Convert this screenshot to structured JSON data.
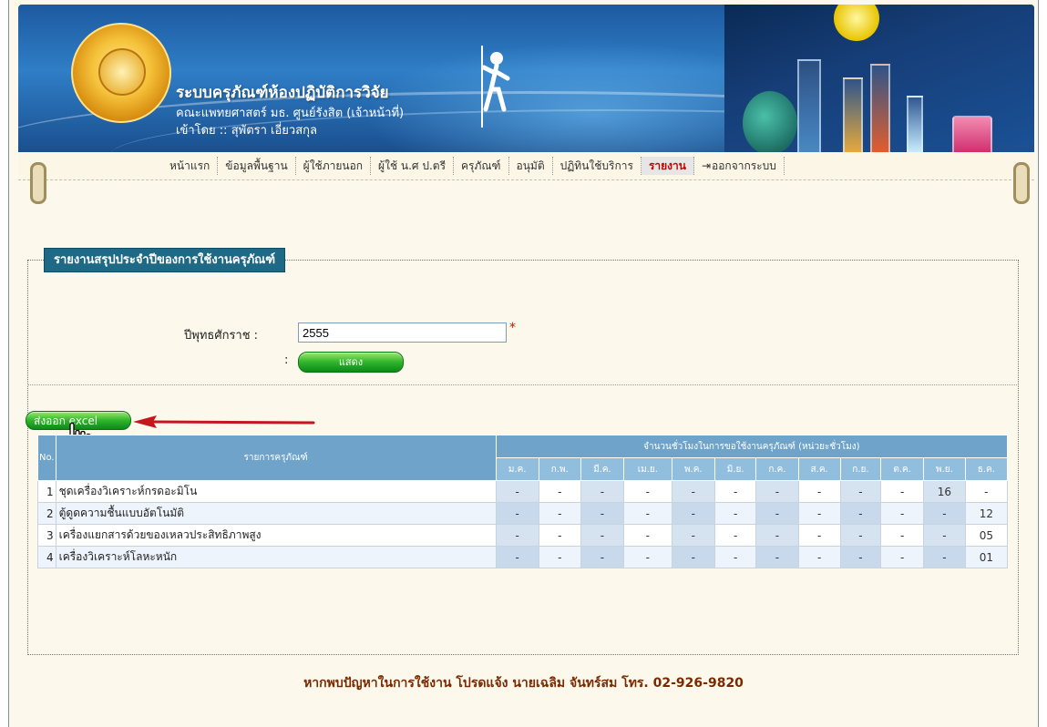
{
  "header": {
    "system_title": "ระบบครุภัณฑ์ห้องปฏิบัติการวิจัย",
    "faculty": "คณะแพทยศาสตร์ มธ. ศูนย์รังสิต (เจ้าหน้าที่)",
    "login": "เข้าโดย :: สุพัตรา เอี่ยวสกุล"
  },
  "nav": {
    "items": [
      {
        "label": "หน้าแรก"
      },
      {
        "label": "ข้อมูลพื้นฐาน"
      },
      {
        "label": "ผู้ใช้ภายนอก"
      },
      {
        "label": "ผู้ใช้ น.ศ ป.ตรี"
      },
      {
        "label": "ครุภัณฑ์"
      },
      {
        "label": "อนุมัติ"
      },
      {
        "label": "ปฏิทินใช้บริการ"
      },
      {
        "label": "รายงาน"
      }
    ],
    "logout": "ออกจากระบบ",
    "active_index": 7
  },
  "report": {
    "legend": "รายงานสรุปประจำปีของการใช้งานครุภัณฑ์",
    "year_label": "ปีพุทธศักราช  :",
    "year_value": "2555",
    "required_mark": "*",
    "colon": ":",
    "show_button": "แสดง",
    "export_button": "ส่งออก excel"
  },
  "table": {
    "col_no": "No.",
    "col_item": "รายการครุภัณฑ์",
    "col_group": "จำนวนชั่วโมงในการขอใช้งานครุภัณฑ์ (หน่วยะชั่วโมง)",
    "months": [
      "ม.ค.",
      "ก.พ.",
      "มี.ค.",
      "เม.ย.",
      "พ.ค.",
      "มิ.ย.",
      "ก.ค.",
      "ส.ค.",
      "ก.ย.",
      "ต.ค.",
      "พ.ย.",
      "ธ.ค."
    ],
    "rows": [
      {
        "no": "1",
        "name": "ชุดเครื่องวิเคราะห์กรดอะมิโน",
        "values": [
          "-",
          "-",
          "-",
          "-",
          "-",
          "-",
          "-",
          "-",
          "-",
          "-",
          "16",
          "-"
        ]
      },
      {
        "no": "2",
        "name": "ตู้ดูดความชื้นแบบอัตโนมัติ",
        "values": [
          "-",
          "-",
          "-",
          "-",
          "-",
          "-",
          "-",
          "-",
          "-",
          "-",
          "-",
          "12"
        ]
      },
      {
        "no": "3",
        "name": "เครื่องแยกสารด้วยของเหลวประสิทธิภาพสูง",
        "values": [
          "-",
          "-",
          "-",
          "-",
          "-",
          "-",
          "-",
          "-",
          "-",
          "-",
          "-",
          "05"
        ]
      },
      {
        "no": "4",
        "name": "เครื่องวิเคราะห์โลหะหนัก",
        "values": [
          "-",
          "-",
          "-",
          "-",
          "-",
          "-",
          "-",
          "-",
          "-",
          "-",
          "-",
          "01"
        ]
      }
    ]
  },
  "footer": {
    "text": "หากพบปัญหาในการใช้งาน โปรดแจ้ง นายเฉลิม จันทร์สม โทร. 02-926-9820"
  },
  "colors": {
    "legend_bg": "#1e6a86",
    "active_nav": "#cc0000",
    "button_green": "#2fb52c",
    "table_header": "#6fa3c9",
    "footer_text": "#7a2a00"
  },
  "icons": [
    "university-logo-icon",
    "logout-icon",
    "red-arrow-icon",
    "hand-cursor-icon"
  ]
}
